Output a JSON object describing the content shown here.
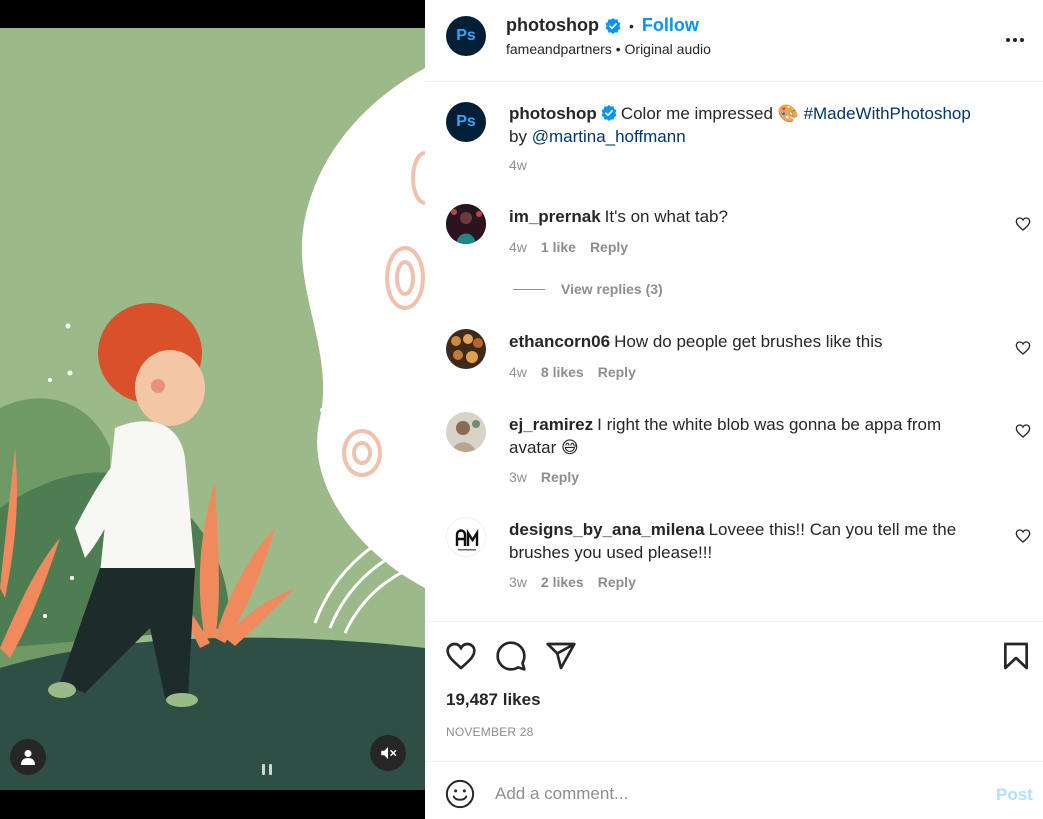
{
  "post": {
    "author": "photoshop",
    "avatar_text": "Ps",
    "follow_label": "Follow",
    "subline": "fameandpartners • Original audio",
    "separator": "•"
  },
  "caption": {
    "author": "photoshop",
    "text": "Color me impressed",
    "emoji": "🎨",
    "hashtag": "#MadeWithPhotoshop",
    "by": "by",
    "mention": "@martina_hoffmann",
    "time": "4w"
  },
  "comments": [
    {
      "user": "im_prernak",
      "text": "It's on what tab?",
      "time": "4w",
      "likes": "1 like",
      "reply": "Reply"
    },
    {
      "user": "ethancorn06",
      "text": "How do people get brushes like this",
      "time": "4w",
      "likes": "8 likes",
      "reply": "Reply"
    },
    {
      "user": "ej_ramirez",
      "text": "I right the white blob was gonna be appa from avatar",
      "emoji": "😅",
      "time": "3w",
      "reply": "Reply"
    },
    {
      "user": "designs_by_ana_milena",
      "text": "Loveee this!! Can you tell me the brushes you used please!!!",
      "time": "3w",
      "likes": "2 likes",
      "reply": "Reply"
    }
  ],
  "view_replies": "View replies (3)",
  "engagement": {
    "likes": "19,487 likes",
    "date": "NOVEMBER 28"
  },
  "composer": {
    "placeholder": "Add a comment...",
    "post_label": "Post"
  },
  "icons": {
    "verified": "verified-badge-icon",
    "more": "more-options-icon",
    "like": "heart-icon",
    "comment": "comment-bubble-icon",
    "share": "paper-plane-icon",
    "save": "bookmark-icon",
    "emoji": "emoji-smiley-icon",
    "user_tag": "user-tag-icon",
    "mute": "speaker-muted-icon"
  },
  "colors": {
    "accent": "#0095f6",
    "ps_bg": "#001e36",
    "ps_text": "#31a8ff",
    "link": "#00376b",
    "muted": "#8e8e8e",
    "art_bg": "#9bb989"
  }
}
